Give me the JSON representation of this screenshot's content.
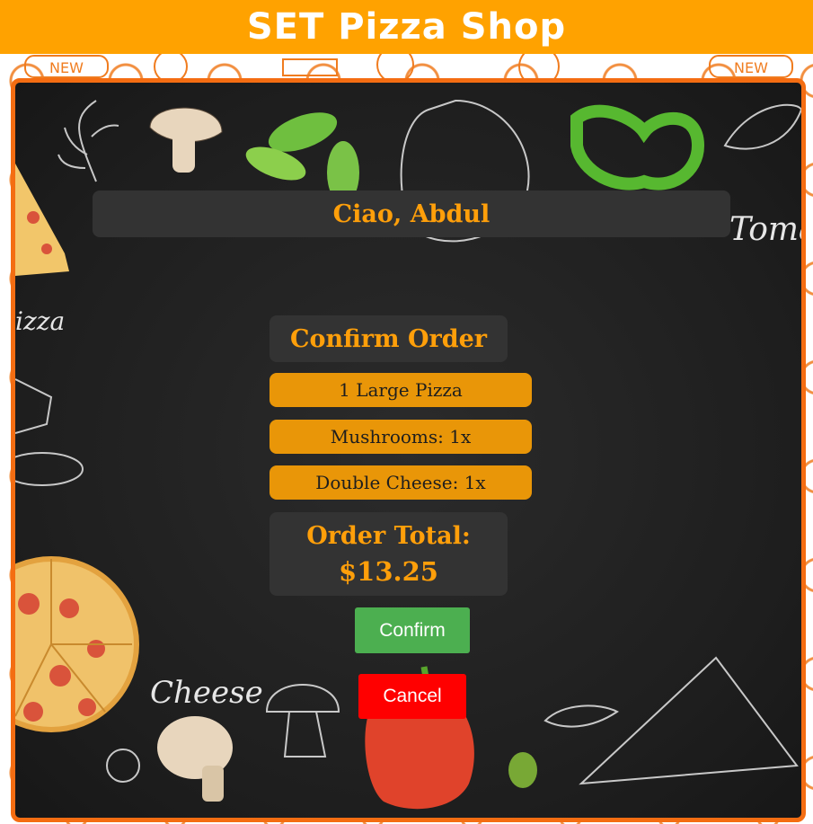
{
  "header": {
    "title": "SET Pizza Shop"
  },
  "greeting": {
    "text": "Ciao, Abdul"
  },
  "order": {
    "title": "Confirm Order",
    "items": [
      "1 Large Pizza",
      "Mushrooms: 1x",
      "Double Cheese: 1x"
    ],
    "total_label": "Order Total:",
    "total_value": "$13.25"
  },
  "actions": {
    "confirm_label": "Confirm",
    "cancel_label": "Cancel"
  },
  "decor": {
    "chalk_labels": [
      "Tomat",
      "izza",
      "Cheese"
    ],
    "badge_text": "NEW"
  },
  "colors": {
    "header_bg": "#ffa200",
    "accent_orange": "#ff9f0a",
    "pill_orange": "#e99608",
    "board_border": "#f46d12",
    "confirm_green": "#4caf50",
    "cancel_red": "#ff0000"
  }
}
